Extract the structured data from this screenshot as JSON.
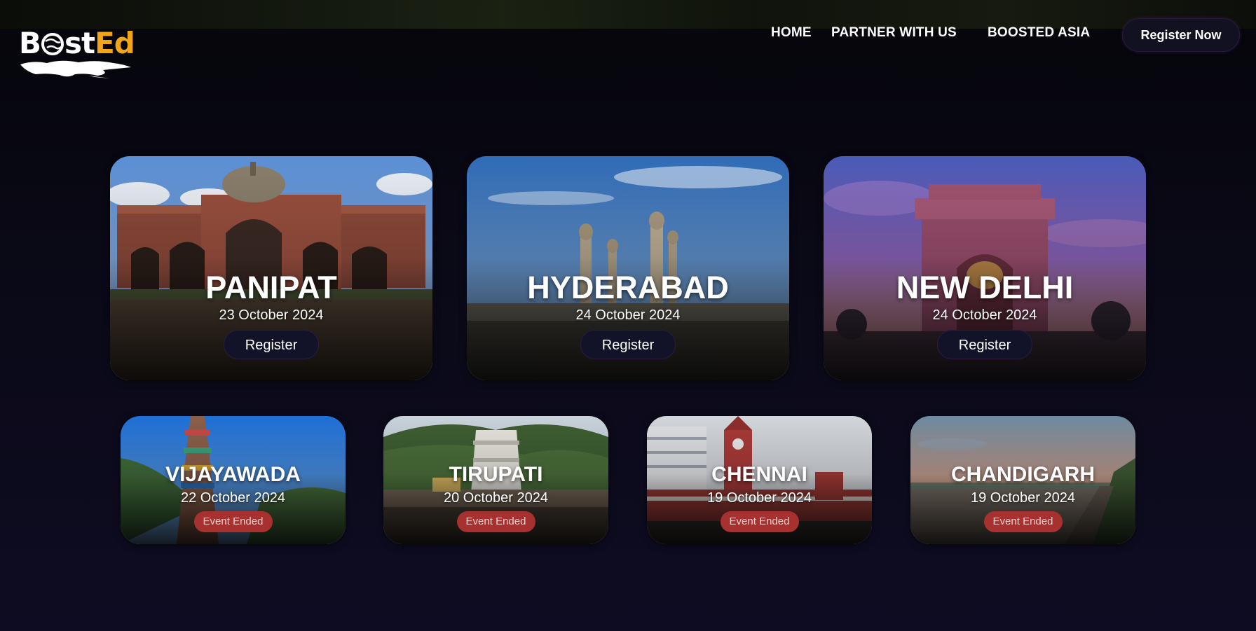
{
  "header": {
    "logo": {
      "text_b": "B",
      "text_mid": "st",
      "text_ed": "Ed",
      "alt": "BoostEd"
    },
    "nav": [
      {
        "label": "HOME"
      },
      {
        "label": "PARTNER WITH US"
      },
      {
        "label": "BOOSTED ASIA"
      }
    ],
    "cta_label": "Register Now"
  },
  "events_featured": [
    {
      "city": "PANIPAT",
      "date": "23 October 2024",
      "button": "Register",
      "image": "mosque-fort"
    },
    {
      "city": "HYDERABAD",
      "date": "24 October 2024",
      "button": "Register",
      "image": "charminar"
    },
    {
      "city": "NEW DELHI",
      "date": "24 October 2024",
      "button": "Register",
      "image": "india-gate"
    }
  ],
  "events_past": [
    {
      "city": "VIJAYAWADA",
      "date": "22 October 2024",
      "status": "Event Ended",
      "image": "temple-gopuram"
    },
    {
      "city": "TIRUPATI",
      "date": "20 October 2024",
      "status": "Event Ended",
      "image": "tirumala-temple"
    },
    {
      "city": "CHENNAI",
      "date": "19 October 2024",
      "status": "Event Ended",
      "image": "central-station"
    },
    {
      "city": "CHANDIGARH",
      "date": "19 October 2024",
      "status": "Event Ended",
      "image": "sukhna-lake"
    }
  ],
  "colors": {
    "background": "#0a0916",
    "accent_logo": "#f2a516",
    "ended_badge": "#a7312e",
    "button_bg": "#121228"
  }
}
